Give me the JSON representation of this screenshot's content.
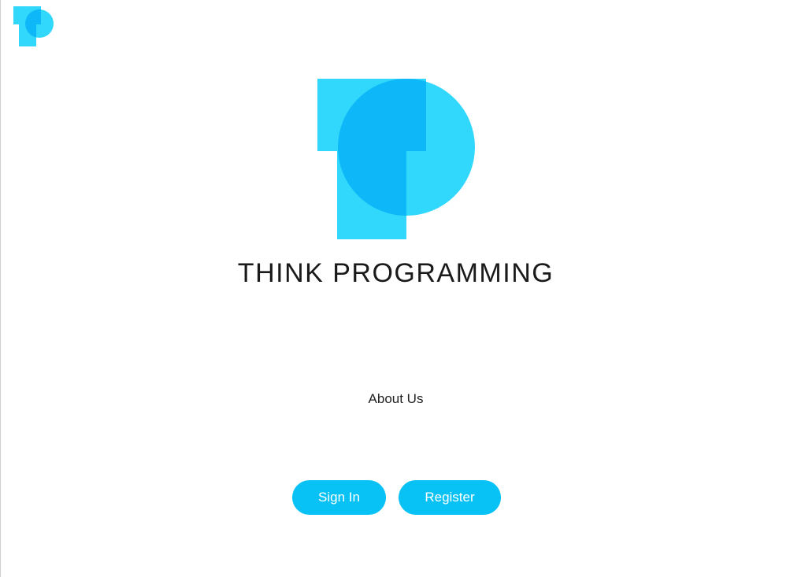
{
  "brand": {
    "title": "THINK PROGRAMMING",
    "logo_icon": "think-programming-logo",
    "colors": {
      "light": "#31d8fb",
      "dark": "#0db7f8",
      "button": "#08c2f5"
    }
  },
  "nav": {
    "about_label": "About Us"
  },
  "actions": {
    "signin_label": "Sign In",
    "register_label": "Register"
  }
}
